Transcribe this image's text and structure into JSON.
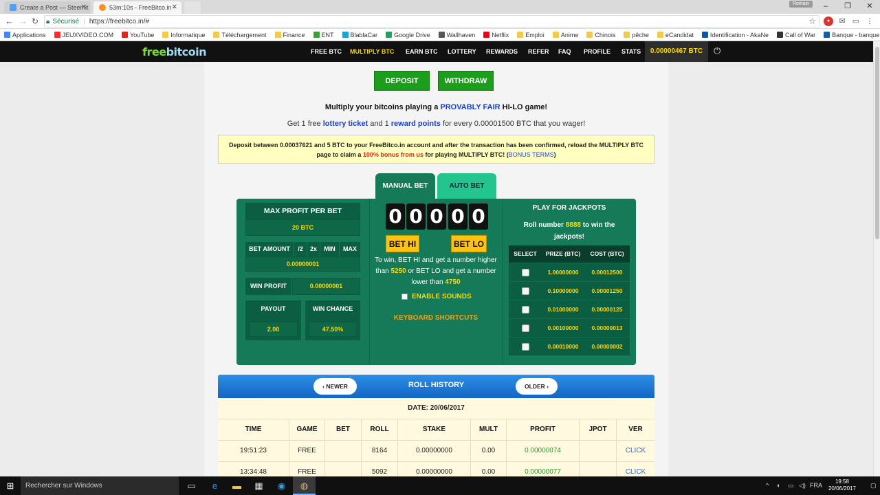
{
  "browser": {
    "tabs": [
      {
        "label": "Create a Post — Steemit",
        "icon": "steemit-icon",
        "color": "#4ba2f2",
        "active": false
      },
      {
        "label": "53m:10s - FreeBitco.in -",
        "icon": "bitcoin-icon",
        "color": "#f7931a",
        "active": true
      }
    ],
    "user": "Romain",
    "secure_label": "Sécurisé",
    "url": "https://freebitco.in/#",
    "bookmarks": [
      {
        "label": "Applications",
        "color": "#4285f4"
      },
      {
        "label": "JEUXVIDEO.COM",
        "color": "#ff2b2b"
      },
      {
        "label": "YouTube",
        "color": "#e62117"
      },
      {
        "label": "Informatique",
        "color": "#f6c94a"
      },
      {
        "label": "Téléchargement",
        "color": "#f6c94a"
      },
      {
        "label": "Finance",
        "color": "#f6c94a"
      },
      {
        "label": "ENT",
        "color": "#3aa03a"
      },
      {
        "label": "BlablaCar",
        "color": "#1fa0d8"
      },
      {
        "label": "Google Drive",
        "color": "#1fa463"
      },
      {
        "label": "Wallhaven",
        "color": "#555555"
      },
      {
        "label": "Netflix",
        "color": "#e50914"
      },
      {
        "label": "Emploi",
        "color": "#f6c94a"
      },
      {
        "label": "Anime",
        "color": "#f6c94a"
      },
      {
        "label": "Chinois",
        "color": "#f6c94a"
      },
      {
        "label": "pêche",
        "color": "#f6c94a"
      },
      {
        "label": "eCandidat",
        "color": "#f6c94a"
      },
      {
        "label": "Identification - AkaNe",
        "color": "#0a5aa8"
      },
      {
        "label": "Call of War",
        "color": "#333333"
      },
      {
        "label": "Banque - banque en l",
        "color": "#1a5aa8"
      }
    ]
  },
  "site": {
    "logo_part1": "free",
    "logo_part2": "bitcoin",
    "nav": [
      "FREE BTC",
      "MULTIPLY BTC",
      "EARN BTC",
      "LOTTERY",
      "REWARDS",
      "REFER",
      "FAQ",
      "PROFILE",
      "STATS"
    ],
    "active_nav": "MULTIPLY BTC",
    "balance": "0.00000467 BTC"
  },
  "actions": {
    "deposit": "DEPOSIT",
    "withdraw": "WITHDRAW"
  },
  "headline": {
    "pre": "Multiply your bitcoins playing a ",
    "highlight": "PROVABLY FAIR",
    "post": " HI-LO game!"
  },
  "subline": {
    "p1": "Get 1 free ",
    "l1": "lottery ticket",
    "p2": " and 1 ",
    "l2": "reward points",
    "p3": " for every 0.00001500 BTC that you wager!"
  },
  "notice": {
    "p1": "Deposit between 0.00037621 and 5 BTC to your FreeBitco.in account and after the transaction has been confirmed, reload the MULTIPLY BTC page to claim a ",
    "red": "100% bonus from us",
    "p2": " for playing MULTIPLY BTC! (",
    "link": "BONUS TERMS",
    "p3": ")"
  },
  "bet_tabs": {
    "manual": "MANUAL BET",
    "auto": "AUTO BET"
  },
  "left_panel": {
    "max_profit_label": "MAX PROFIT PER BET",
    "max_profit_value": "20 BTC",
    "bet_amount_label": "BET AMOUNT",
    "bet_mods": [
      "/2",
      "2x",
      "MIN",
      "MAX"
    ],
    "bet_amount_value": "0.00000001",
    "win_profit_label": "WIN PROFIT",
    "win_profit_value": "0.00000001",
    "payout_label": "PAYOUT",
    "payout_value": "2.00",
    "win_chance_label": "WIN CHANCE",
    "win_chance_value": "47.50%"
  },
  "center_panel": {
    "digits": [
      "0",
      "0",
      "0",
      "0",
      "0"
    ],
    "bet_hi": "BET HI",
    "bet_lo": "BET LO",
    "info_p1": "To win, BET HI and get a number higher than ",
    "hi_threshold": "5250",
    "info_p2": " or BET LO and get a number lower than ",
    "lo_threshold": "4750",
    "enable_sounds": "ENABLE SOUNDS",
    "keyboard_shortcuts": "KEYBOARD SHORTCUTS"
  },
  "jackpot": {
    "title": "PLAY FOR JACKPOTS",
    "roll_p1": "Roll number ",
    "roll_number": "8888",
    "roll_p2": " to win the jackpots!",
    "headers": [
      "SELECT",
      "PRIZE (BTC)",
      "COST (BTC)"
    ],
    "rows": [
      {
        "prize": "1.00000000",
        "cost": "0.00012500"
      },
      {
        "prize": "0.10000000",
        "cost": "0.00001250"
      },
      {
        "prize": "0.01000000",
        "cost": "0.00000125"
      },
      {
        "prize": "0.00100000",
        "cost": "0.00000013"
      },
      {
        "prize": "0.00010000",
        "cost": "0.00000002"
      }
    ]
  },
  "roll_history": {
    "title": "ROLL HISTORY",
    "newer": "NEWER",
    "older": "OLDER",
    "date": "DATE: 20/06/2017",
    "columns": [
      "TIME",
      "GAME",
      "BET",
      "ROLL",
      "STAKE",
      "MULT",
      "PROFIT",
      "JPOT",
      "VER"
    ],
    "rows": [
      [
        "19:51:23",
        "FREE",
        "",
        "8164",
        "0.00000000",
        "0.00",
        "0.00000074",
        "",
        "CLICK"
      ],
      [
        "13:34:48",
        "FREE",
        "",
        "5092",
        "0.00000000",
        "0.00",
        "0.00000077",
        "",
        "CLICK"
      ]
    ]
  },
  "taskbar": {
    "search_placeholder": "Rechercher sur Windows",
    "lang": "FRA",
    "time": "19:58",
    "date": "20/06/2017"
  }
}
